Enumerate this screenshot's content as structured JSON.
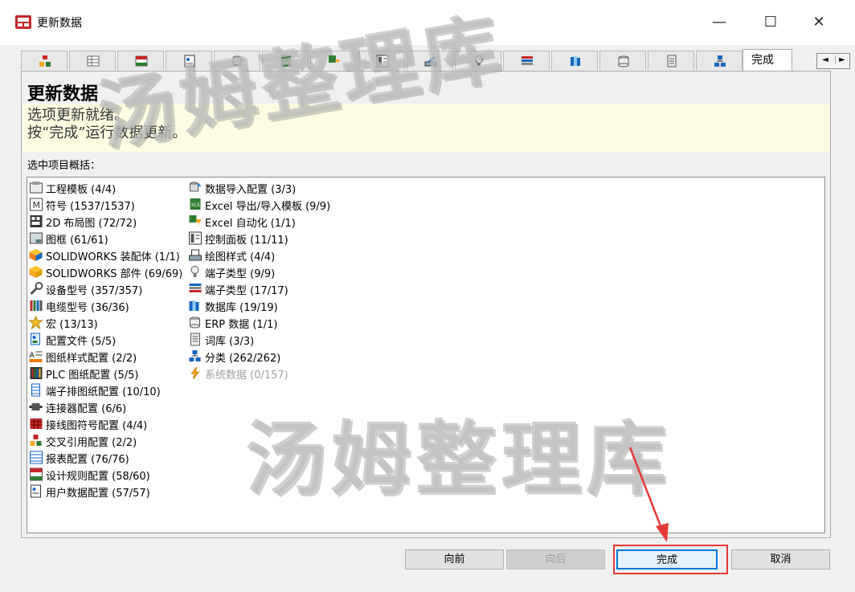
{
  "window": {
    "title": "更新数据",
    "minimize": "—",
    "maximize": "☐",
    "close": "✕"
  },
  "tabs": {
    "icons": [
      "workflow-icon",
      "table-icon",
      "grid-icon",
      "id-card-icon",
      "database-import-icon",
      "excel-icon",
      "automation-icon",
      "panel-icon",
      "drawing-style-icon",
      "lightbulb-icon",
      "stack-icon",
      "library-icon",
      "db-icon",
      "page-icon",
      "hierarchy-icon"
    ],
    "active_label": "完成",
    "scroll_left": "◄",
    "scroll_right": "►"
  },
  "header": {
    "title": "更新数据",
    "line1": "选项更新就绪。",
    "line2": "按“完成”运行数据更新。"
  },
  "summary": {
    "label": "选中项目概括：",
    "col1": [
      {
        "label": "工程模板 (4/4)",
        "icon": "project-template-icon"
      },
      {
        "label": "符号 (1537/1537)",
        "icon": "symbol-icon"
      },
      {
        "label": "2D 布局图 (72/72)",
        "icon": "layout-2d-icon"
      },
      {
        "label": "图框 (61/61)",
        "icon": "title-block-icon"
      },
      {
        "label": "SOLIDWORKS 装配体 (1/1)",
        "icon": "sw-assembly-icon"
      },
      {
        "label": "SOLIDWORKS 部件 (69/69)",
        "icon": "sw-part-icon"
      },
      {
        "label": "设备型号 (357/357)",
        "icon": "wrench-icon"
      },
      {
        "label": "电缆型号 (36/36)",
        "icon": "cable-icon"
      },
      {
        "label": "宏 (13/13)",
        "icon": "star-icon"
      },
      {
        "label": "配置文件 (5/5)",
        "icon": "config-file-icon"
      },
      {
        "label": "图纸样式配置 (2/2)",
        "icon": "drawing-style-icon"
      },
      {
        "label": "PLC 图纸配置 (5/5)",
        "icon": "plc-icon"
      },
      {
        "label": "端子排图纸配置 (10/10)",
        "icon": "terminal-strip-icon"
      },
      {
        "label": "连接器配置 (6/6)",
        "icon": "connector-icon"
      },
      {
        "label": "接线图符号配置 (4/4)",
        "icon": "wiring-symbol-icon"
      },
      {
        "label": "交叉引用配置 (2/2)",
        "icon": "cross-ref-icon"
      },
      {
        "label": "报表配置 (76/76)",
        "icon": "report-icon"
      },
      {
        "label": "设计规则配置 (58/60)",
        "icon": "design-rule-icon"
      },
      {
        "label": "用户数据配置 (57/57)",
        "icon": "user-data-icon"
      }
    ],
    "col2": [
      {
        "label": "数据导入配置 (3/3)",
        "icon": "data-import-icon"
      },
      {
        "label": "Excel 导出/导入模板 (9/9)",
        "icon": "excel-template-icon"
      },
      {
        "label": "Excel 自动化 (1/1)",
        "icon": "excel-automation-icon"
      },
      {
        "label": "控制面板 (11/11)",
        "icon": "control-panel-icon"
      },
      {
        "label": "绘图样式 (4/4)",
        "icon": "plot-style-icon"
      },
      {
        "label": "端子类型 (9/9)",
        "icon": "terminal-type-icon"
      },
      {
        "label": "端子类型 (17/17)",
        "icon": "terminal-type2-icon"
      },
      {
        "label": "数据库 (19/19)",
        "icon": "database-icon"
      },
      {
        "label": "ERP 数据 (1/1)",
        "icon": "erp-icon"
      },
      {
        "label": "词库 (3/3)",
        "icon": "dictionary-icon"
      },
      {
        "label": "分类 (262/262)",
        "icon": "classification-icon"
      },
      {
        "label": "系统数据 (0/157)",
        "icon": "system-data-icon",
        "disabled": true
      }
    ]
  },
  "watermark": {
    "text1": "汤姆整理库",
    "text2": "汤姆整理库"
  },
  "buttons": {
    "back": "向前",
    "next": "向后",
    "finish": "完成",
    "cancel": "取消"
  }
}
